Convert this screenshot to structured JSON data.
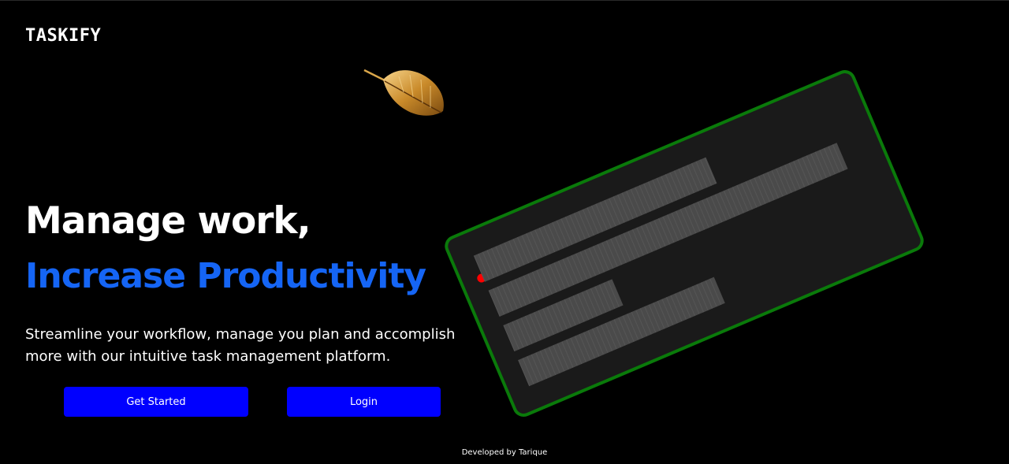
{
  "brand": {
    "logo_text": "TASKIFY"
  },
  "hero": {
    "headline": "Manage work,",
    "headline_accent": "Increase Productivity",
    "description": "Streamline your workflow, manage you plan and accomplish more with our intuitive task management platform."
  },
  "actions": {
    "get_started_label": "Get Started",
    "login_label": "Login"
  },
  "footer": {
    "credit": "Developed by Tarique"
  },
  "colors": {
    "background": "#000000",
    "accent": "#1565f5",
    "button": "#0000ff",
    "mockup_border": "#0a7a0a",
    "mockup_body": "#1a1a1a",
    "dot_red": "#ff0000",
    "dot_yellow": "#ffd700",
    "dot_green": "#008000"
  },
  "icons": {
    "decoration": "golden-feather-icon"
  }
}
